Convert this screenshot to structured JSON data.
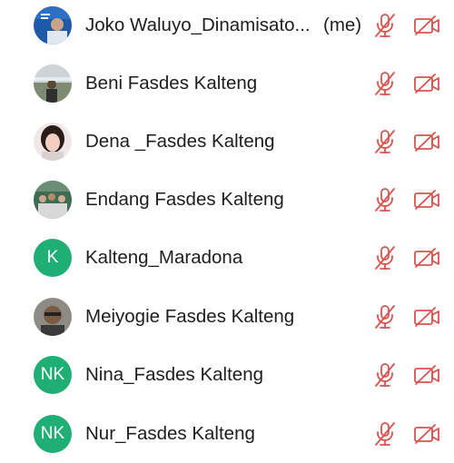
{
  "participants": [
    {
      "name": "Joko Waluyo_Dinamisato...",
      "suffix": "(me)",
      "avatar": "photo-icon",
      "mic": "mic-muted-icon",
      "camera": "camera-off-icon"
    },
    {
      "name": "Beni Fasdes Kalteng",
      "avatar": "photo-icon",
      "mic": "mic-muted-icon",
      "camera": "camera-off-icon"
    },
    {
      "name": "Dena _Fasdes Kalteng",
      "avatar": "photo-icon",
      "mic": "mic-muted-icon",
      "camera": "camera-off-icon"
    },
    {
      "name": "Endang Fasdes Kalteng",
      "avatar": "photo-icon",
      "mic": "mic-muted-icon",
      "camera": "camera-off-icon"
    },
    {
      "name": "Kalteng_Maradona",
      "initials": "K",
      "mic": "mic-muted-icon",
      "camera": "camera-off-icon"
    },
    {
      "name": "Meiyogie Fasdes Kalteng",
      "avatar": "photo-icon",
      "mic": "mic-muted-icon",
      "camera": "camera-off-icon"
    },
    {
      "name": "Nina_Fasdes Kalteng",
      "initials": "NK",
      "mic": "mic-muted-icon",
      "camera": "camera-off-icon"
    },
    {
      "name": "Nur_Fasdes Kalteng",
      "initials": "NK",
      "mic": "mic-muted-icon",
      "camera": "camera-off-icon"
    }
  ],
  "colors": {
    "muted_icon": "#d9534f",
    "initials_avatar": "#1fae73",
    "text": "#1d1d1d"
  }
}
